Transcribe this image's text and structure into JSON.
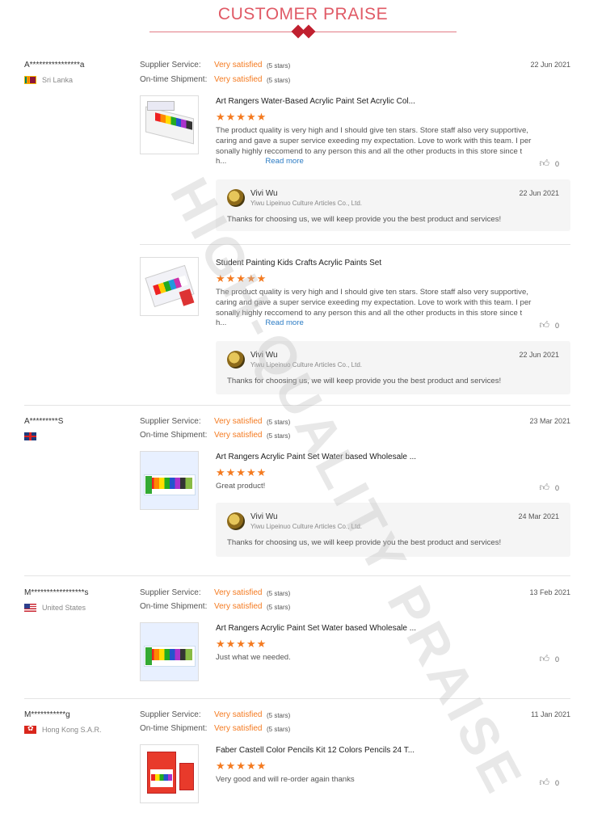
{
  "header": {
    "title": "CUSTOMER PRAISE"
  },
  "watermark": "HIGH-QUALITY PRAISE",
  "labels": {
    "supplier_service": "Supplier Service:",
    "ontime_shipment": "On-time Shipment:",
    "read_more": "Read more"
  },
  "reviews": [
    {
      "name": "A****************a",
      "country": "Sri Lanka",
      "flag_icon": "sri-lanka-flag-icon",
      "date": "22 Jun 2021",
      "supplier_service": "Very satisfied",
      "supplier_stars": "(5 stars)",
      "ontime_shipment": "Very satisfied",
      "ontime_stars": "(5 stars)",
      "products": [
        {
          "title": "Art Rangers Water-Based Acrylic Paint Set Acrylic Col...",
          "rating": 5,
          "stars": "★★★★★",
          "text": "The product quality is very high and I should give ten stars. Store staff also very supportive, caring and gave a super service exeeding my expectation. Love to work with this team. I per sonally highly reccomend to any person this and all the other products in this store since t h...",
          "likes": "0",
          "reply": {
            "name": "Vivi Wu",
            "company": "Yiwu Lipeinuo Culture Articles Co., Ltd.",
            "date": "22 Jun 2021",
            "text": "Thanks for choosing us, we will keep provide you the best product and services!"
          }
        },
        {
          "title": "Student Painting Kids Crafts Acrylic Paints Set",
          "rating": 5,
          "stars": "★★★★★",
          "text": "The product quality is very high and I should give ten stars. Store staff also very supportive, caring and gave a super service exeeding my expectation. Love to work with this team. I per sonally highly reccomend to any person this and all the other products in this store since t h...",
          "likes": "0",
          "reply": {
            "name": "Vivi Wu",
            "company": "Yiwu Lipeinuo Culture Articles Co., Ltd.",
            "date": "22 Jun 2021",
            "text": "Thanks for choosing us, we will keep provide you the best product and services!"
          }
        }
      ]
    },
    {
      "name": "A*********S",
      "country": "",
      "flag_icon": "uk-flag-icon",
      "date": "23 Mar 2021",
      "supplier_service": "Very satisfied",
      "supplier_stars": "(5 stars)",
      "ontime_shipment": "Very satisfied",
      "ontime_stars": "(5 stars)",
      "products": [
        {
          "title": "Art Rangers Acrylic Paint Set Water based Wholesale ...",
          "rating": 5,
          "stars": "★★★★★",
          "text": "Great product!",
          "likes": "0",
          "reply": {
            "name": "Vivi Wu",
            "company": "Yiwu Lipeinuo Culture Articles Co., Ltd.",
            "date": "24 Mar 2021",
            "text": "Thanks for choosing us, we will keep provide you the best product and services!"
          }
        }
      ]
    },
    {
      "name": "M*****************s",
      "country": "United States",
      "flag_icon": "us-flag-icon",
      "date": "13 Feb 2021",
      "supplier_service": "Very satisfied",
      "supplier_stars": "(5 stars)",
      "ontime_shipment": "Very satisfied",
      "ontime_stars": "(5 stars)",
      "products": [
        {
          "title": "Art Rangers Acrylic Paint Set Water based Wholesale ...",
          "rating": 5,
          "stars": "★★★★★",
          "text": "Just what we needed.",
          "likes": "0"
        }
      ]
    },
    {
      "name": "M***********g",
      "country": "Hong Kong S.A.R.",
      "flag_icon": "hong-kong-flag-icon",
      "date": "11 Jan 2021",
      "supplier_service": "Very satisfied",
      "supplier_stars": "(5 stars)",
      "ontime_shipment": "Very satisfied",
      "ontime_stars": "(5 stars)",
      "products": [
        {
          "title": "Faber Castell Color Pencils Kit 12 Colors Pencils 24 T...",
          "rating": 5,
          "stars": "★★★★★",
          "text": "Very good and will re-order again thanks",
          "likes": "0"
        }
      ]
    }
  ]
}
